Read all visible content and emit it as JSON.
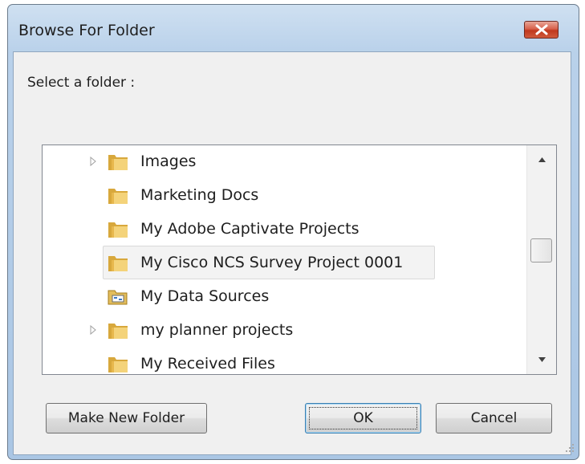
{
  "window": {
    "title": "Browse For Folder",
    "close_icon": "close-icon"
  },
  "prompt": "Select a folder :",
  "tree": {
    "items": [
      {
        "label": "Images",
        "icon": "folder-icon",
        "expandable": true
      },
      {
        "label": "Marketing Docs",
        "icon": "folder-icon",
        "expandable": false
      },
      {
        "label": "My Adobe Captivate Projects",
        "icon": "folder-icon",
        "expandable": false
      },
      {
        "label": "My Cisco NCS Survey Project 0001",
        "icon": "folder-icon",
        "expandable": false,
        "selected": true
      },
      {
        "label": "My Data Sources",
        "icon": "data-sources-folder-icon",
        "expandable": false
      },
      {
        "label": "my planner projects",
        "icon": "folder-icon",
        "expandable": true
      },
      {
        "label": "My Received Files",
        "icon": "folder-icon",
        "expandable": false
      }
    ]
  },
  "buttons": {
    "make_new_folder": "Make New Folder",
    "ok": "OK",
    "cancel": "Cancel"
  }
}
